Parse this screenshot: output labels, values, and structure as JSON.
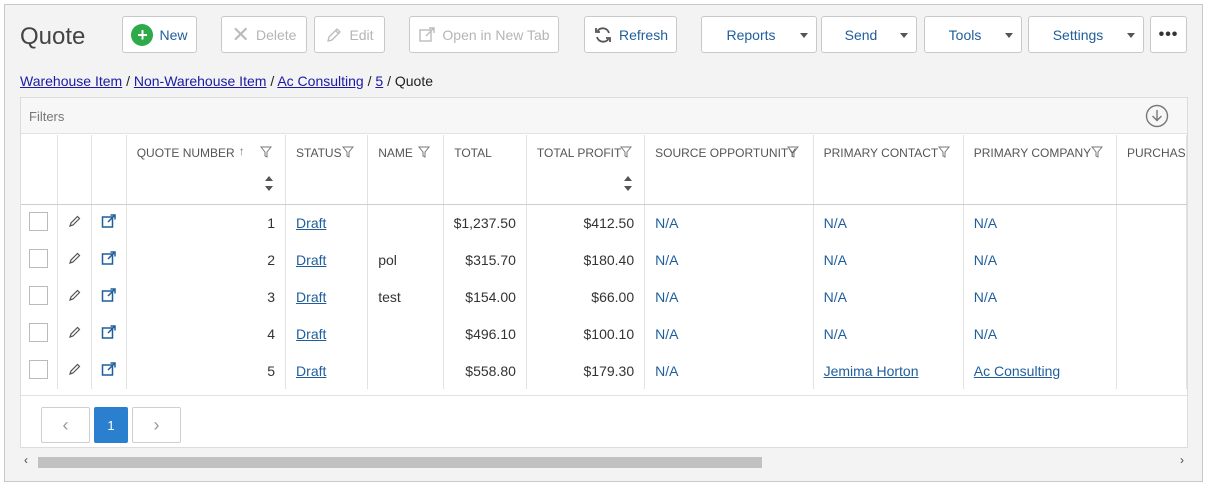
{
  "page": {
    "title": "Quote"
  },
  "toolbar": {
    "new": "New",
    "delete": "Delete",
    "edit": "Edit",
    "open_new_tab": "Open in New Tab",
    "refresh": "Refresh",
    "reports": "Reports",
    "send": "Send",
    "tools": "Tools",
    "settings": "Settings",
    "more": "•••"
  },
  "breadcrumb": {
    "items": [
      "Warehouse Item",
      "Non-Warehouse Item",
      "Ac Consulting",
      "5"
    ],
    "separator": "/",
    "current": "Quote"
  },
  "filters": {
    "label": "Filters"
  },
  "columns": {
    "quote_number": "QUOTE NUMBER",
    "status": "STATUS",
    "name": "NAME",
    "total": "TOTAL",
    "total_profit": "TOTAL PROFIT",
    "source_opportunity": "SOURCE OPPORTUNITY",
    "primary_contact": "PRIMARY CONTACT",
    "primary_company": "PRIMARY COMPANY",
    "purchase": "PURCHAS"
  },
  "rows": [
    {
      "quote_number": "1",
      "status": "Draft",
      "name": "",
      "total": "$1,237.50",
      "total_profit": "$412.50",
      "source_opportunity": "N/A",
      "primary_contact": "N/A",
      "primary_company": "N/A"
    },
    {
      "quote_number": "2",
      "status": "Draft",
      "name": "pol",
      "total": "$315.70",
      "total_profit": "$180.40",
      "source_opportunity": "N/A",
      "primary_contact": "N/A",
      "primary_company": "N/A"
    },
    {
      "quote_number": "3",
      "status": "Draft",
      "name": "test",
      "total": "$154.00",
      "total_profit": "$66.00",
      "source_opportunity": "N/A",
      "primary_contact": "N/A",
      "primary_company": "N/A"
    },
    {
      "quote_number": "4",
      "status": "Draft",
      "name": "",
      "total": "$496.10",
      "total_profit": "$100.10",
      "source_opportunity": "N/A",
      "primary_contact": "N/A",
      "primary_company": "N/A"
    },
    {
      "quote_number": "5",
      "status": "Draft",
      "name": "",
      "total": "$558.80",
      "total_profit": "$179.30",
      "source_opportunity": "N/A",
      "primary_contact": "Jemima Horton",
      "primary_company": "Ac Consulting"
    }
  ],
  "pager": {
    "prev": "‹",
    "current": "1",
    "next": "›"
  },
  "icons": {
    "new": "plus-circle-icon",
    "delete": "x-icon",
    "edit": "pencil-icon",
    "open": "external-link-icon",
    "refresh": "refresh-icon",
    "download": "download-circle-icon",
    "filter": "funnel-icon"
  },
  "colors": {
    "accent": "#1f5e9c",
    "new_green": "#2eaa4a",
    "pager_active": "#2a7fcf"
  }
}
